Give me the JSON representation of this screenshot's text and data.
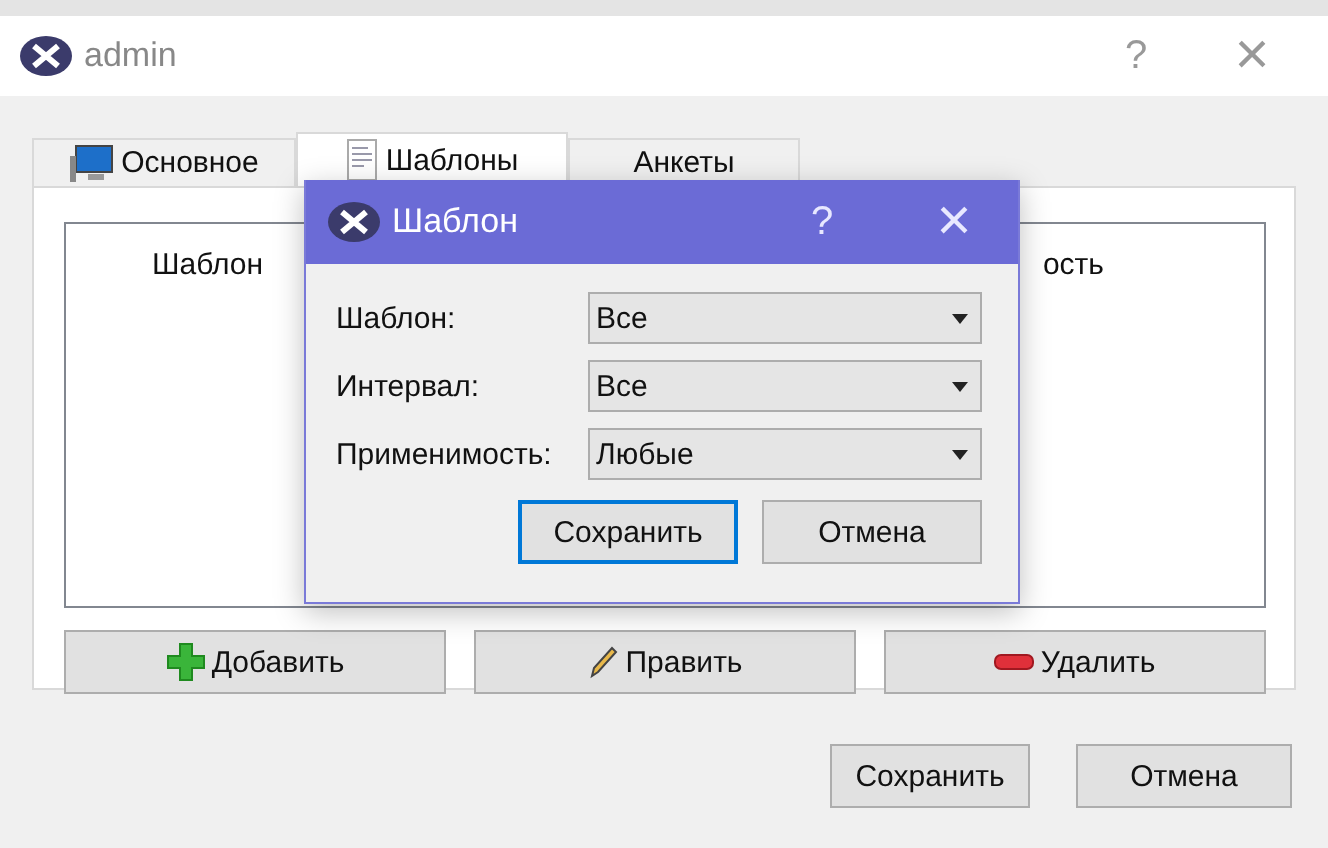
{
  "window": {
    "title": "admin",
    "help": "?",
    "close": "×"
  },
  "tabs": [
    {
      "label": "Основное",
      "kind": "monitor",
      "selected": false
    },
    {
      "label": "Шаблоны",
      "kind": "document",
      "selected": true
    },
    {
      "label": "Анкеты",
      "kind": "plain",
      "selected": false
    }
  ],
  "list": {
    "column_1": "Шаблон",
    "column_3": "ость"
  },
  "list_buttons": [
    {
      "label": "Добавить",
      "kind": "add"
    },
    {
      "label": "Править",
      "kind": "edit"
    },
    {
      "label": "Удалить",
      "kind": "delete"
    }
  ],
  "buttons": [
    "Сохранить",
    "Отмена"
  ],
  "dialog": {
    "title": "Шаблон",
    "help": "?",
    "close": "×",
    "fields": [
      {
        "label": "Шаблон:",
        "value": "Все"
      },
      {
        "label": "Интервал:",
        "value": "Все"
      },
      {
        "label": "Применимость:",
        "value": "Любые"
      }
    ],
    "buttons": [
      {
        "label": "Сохранить",
        "selected": true
      },
      {
        "label": "Отмена",
        "selected": false
      }
    ]
  }
}
